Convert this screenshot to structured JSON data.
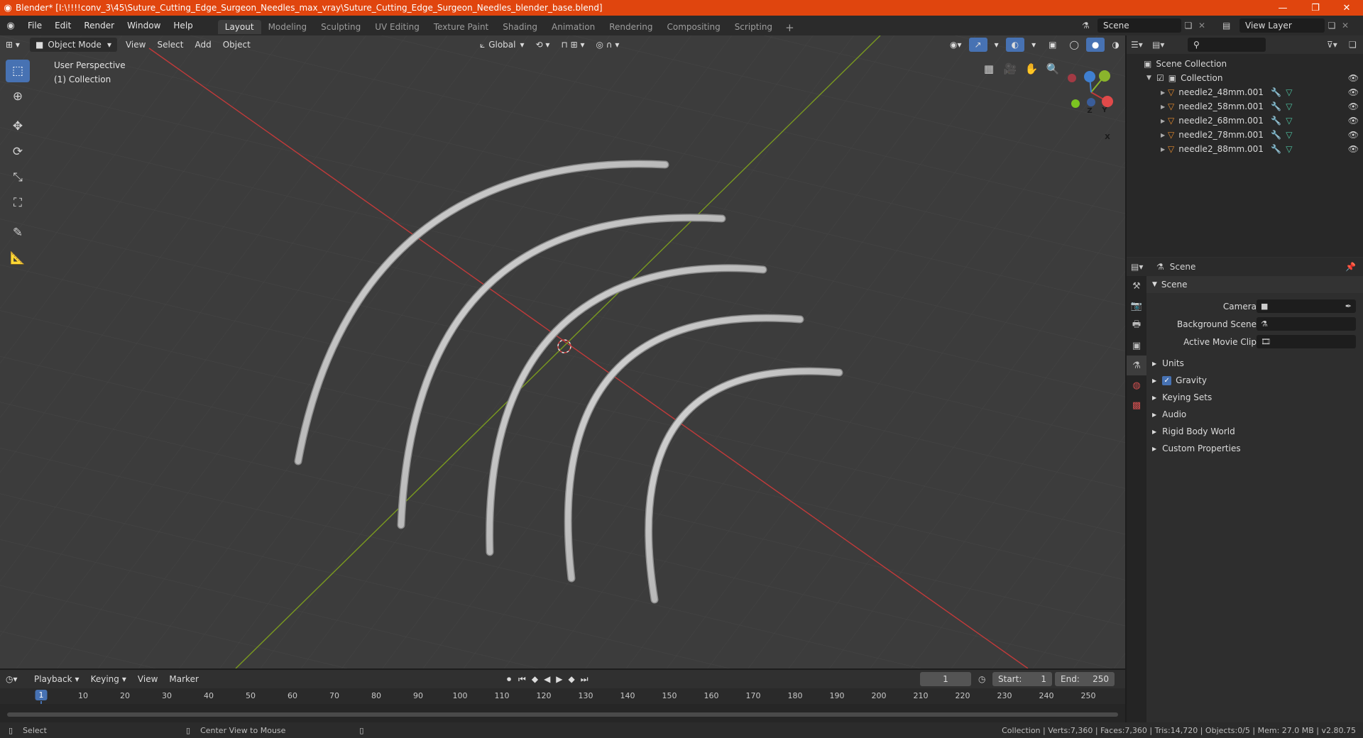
{
  "window": {
    "title": "Blender* [I:\\!!!!conv_3\\45\\Suture_Cutting_Edge_Surgeon_Needles_max_vray\\Suture_Cutting_Edge_Surgeon_Needles_blender_base.blend]",
    "minimize": "—",
    "maximize": "❐",
    "close": "✕"
  },
  "menu": [
    "File",
    "Edit",
    "Render",
    "Window",
    "Help"
  ],
  "workspaces": [
    "Layout",
    "Modeling",
    "Sculpting",
    "UV Editing",
    "Texture Paint",
    "Shading",
    "Animation",
    "Rendering",
    "Compositing",
    "Scripting"
  ],
  "active_workspace": "Layout",
  "scene_name": "Scene",
  "view_layer": "View Layer",
  "viewport": {
    "mode": "Object Mode",
    "menus": [
      "View",
      "Select",
      "Add",
      "Object"
    ],
    "orientation": "Global",
    "info_line1": "User Perspective",
    "info_line2": "(1) Collection",
    "gizmo": {
      "x": "X",
      "y": "Y",
      "z": "Z"
    }
  },
  "outliner": {
    "root": "Scene Collection",
    "collection": "Collection",
    "items": [
      {
        "name": "needle2_48mm.001"
      },
      {
        "name": "needle2_58mm.001"
      },
      {
        "name": "needle2_68mm.001"
      },
      {
        "name": "needle2_78mm.001"
      },
      {
        "name": "needle2_88mm.001"
      }
    ]
  },
  "properties": {
    "header": "Scene",
    "section": "Scene",
    "fields": [
      {
        "label": "Camera"
      },
      {
        "label": "Background Scene"
      },
      {
        "label": "Active Movie Clip"
      }
    ],
    "panels": [
      {
        "label": "Units",
        "checkbox": false
      },
      {
        "label": "Gravity",
        "checkbox": true
      },
      {
        "label": "Keying Sets",
        "checkbox": false
      },
      {
        "label": "Audio",
        "checkbox": false
      },
      {
        "label": "Rigid Body World",
        "checkbox": false
      },
      {
        "label": "Custom Properties",
        "checkbox": false
      }
    ]
  },
  "timeline": {
    "menus": [
      "Playback",
      "Keying",
      "View",
      "Marker"
    ],
    "current_frame": "1",
    "start_label": "Start:",
    "start": "1",
    "end_label": "End:",
    "end": "250",
    "ticks": [
      "1",
      "10",
      "20",
      "30",
      "40",
      "50",
      "60",
      "70",
      "80",
      "90",
      "100",
      "110",
      "120",
      "130",
      "140",
      "150",
      "160",
      "170",
      "180",
      "190",
      "200",
      "210",
      "220",
      "230",
      "240",
      "250"
    ]
  },
  "status": {
    "left": "Select",
    "middle": "Center View to Mouse",
    "right": "Collection | Verts:7,360 | Faces:7,360 | Tris:14,720 | Objects:0/5 | Mem: 27.0 MB | v2.80.75"
  },
  "colors": {
    "titlebar": "#e0450e",
    "accent": "#4772b3",
    "axis_x": "#c23a3a",
    "axis_y": "#7a9a1f",
    "object_icon": "#e58a2c",
    "mesh_icon": "#4fc3a1"
  }
}
